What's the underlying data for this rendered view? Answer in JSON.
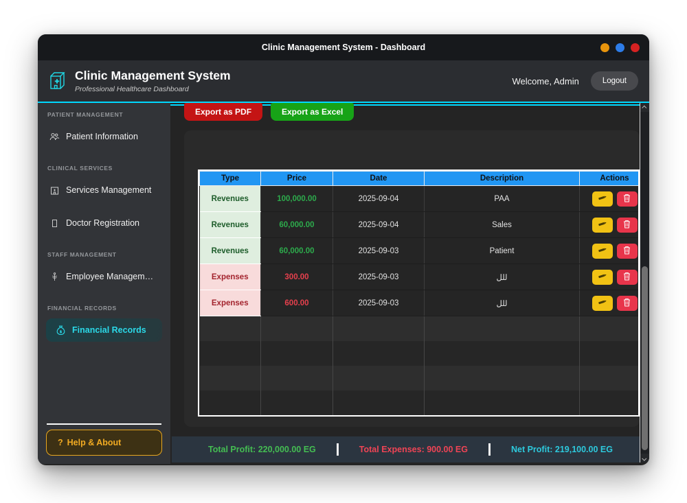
{
  "window": {
    "title": "Clinic Management System - Dashboard",
    "controls": [
      {
        "name": "minimize",
        "color": "#e8940c"
      },
      {
        "name": "maximize",
        "color": "#2d7ce8"
      },
      {
        "name": "close",
        "color": "#d62222"
      }
    ]
  },
  "header": {
    "logo_icon": "hospital-icon",
    "title": "Clinic Management System",
    "subtitle": "Professional Healthcare Dashboard",
    "welcome": "Welcome, Admin",
    "logout_label": "Logout"
  },
  "sidebar": {
    "sections": [
      {
        "label": "PATIENT MANAGEMENT",
        "items": [
          {
            "icon": "patients-icon",
            "label": "Patient Information",
            "active": false
          }
        ]
      },
      {
        "label": "CLINICAL SERVICES",
        "items": [
          {
            "icon": "services-icon",
            "label": "Services Management",
            "active": false
          },
          {
            "icon": "doctor-icon",
            "label": "Doctor Registration",
            "active": false
          }
        ]
      },
      {
        "label": "STAFF MANAGEMENT",
        "items": [
          {
            "icon": "staff-icon",
            "label": "Employee Managem…",
            "active": false
          }
        ]
      },
      {
        "label": "FINANCIAL RECORDS",
        "items": [
          {
            "icon": "finance-icon",
            "label": "Financial Records",
            "active": true
          }
        ]
      }
    ],
    "help": {
      "icon_text": "?",
      "label": "Help & About"
    }
  },
  "toolbar": {
    "export_pdf_label": "Export as PDF",
    "export_excel_label": "Export as Excel"
  },
  "table": {
    "columns": [
      "Type",
      "Price",
      "Date",
      "Description",
      "Actions"
    ],
    "rows": [
      {
        "type": "Revenues",
        "price": "100,000.00",
        "date": "2025-09-04",
        "description": "PAA"
      },
      {
        "type": "Revenues",
        "price": "60,000.00",
        "date": "2025-09-04",
        "description": "Sales"
      },
      {
        "type": "Revenues",
        "price": "60,000.00",
        "date": "2025-09-03",
        "description": "Patient"
      },
      {
        "type": "Expenses",
        "price": "300.00",
        "date": "2025-09-03",
        "description": "للل"
      },
      {
        "type": "Expenses",
        "price": "600.00",
        "date": "2025-09-03",
        "description": "للل"
      }
    ],
    "empty_row_count": 4,
    "action_icons": [
      "pencil-icon",
      "trash-icon"
    ]
  },
  "statusbar": {
    "total_profit": "Total Profit: 220,000.00 EG",
    "total_expenses": "Total Expenses: 900.00 EG",
    "net_profit": "Net Profit: 219,100.00 EG"
  },
  "colors": {
    "accent_cyan": "#00d9ff",
    "table_header_blue": "#2196f3",
    "pdf_red": "#c41414",
    "excel_green": "#17a317",
    "profit_green": "#44bd52",
    "expense_red": "#ef4455",
    "net_cyan": "#2dc9dd",
    "revenue_cell_bg": "#dfeedf",
    "expense_cell_bg": "#f8dbdb",
    "edit_yellow": "#f1c214",
    "delete_red": "#e8354b"
  }
}
